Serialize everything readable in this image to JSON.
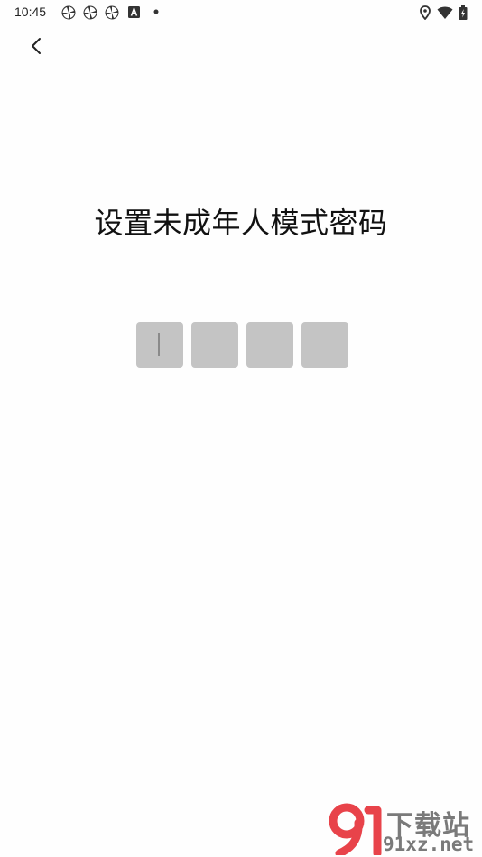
{
  "status_bar": {
    "time": "10:45",
    "left_icons": [
      "pinwheel-icon",
      "pinwheel-icon",
      "pinwheel-icon",
      "a-box-icon",
      "dot-icon"
    ],
    "right_icons": [
      "location-icon",
      "wifi-icon",
      "battery-icon"
    ]
  },
  "header": {
    "back_icon": "chevron-left-icon"
  },
  "main": {
    "title": "设置未成年人模式密码",
    "pin_length": 4,
    "pin_box_color": "#c4c4c4"
  },
  "watermark": {
    "line1": "下载站",
    "line2": "91xz.net",
    "logo_color": "#e8434a"
  }
}
